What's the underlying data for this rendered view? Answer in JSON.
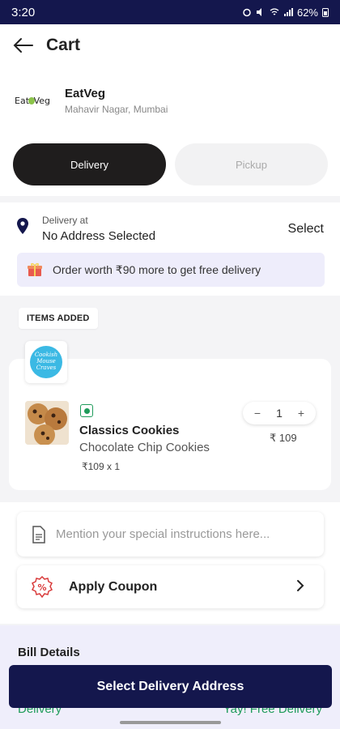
{
  "status_bar": {
    "time": "3:20",
    "battery": "62%"
  },
  "header": {
    "title": "Cart"
  },
  "restaurant": {
    "logo_text_left": "Eat",
    "logo_text_right": "Veg",
    "name": "EatVeg",
    "address": "Mahavir Nagar, Mumbai"
  },
  "mode_toggle": {
    "delivery_label": "Delivery",
    "pickup_label": "Pickup"
  },
  "delivery": {
    "label": "Delivery at",
    "value": "No Address Selected",
    "select_label": "Select",
    "promo_text": "Order worth ₹90 more to get free delivery"
  },
  "items_section": {
    "tag": "ITEMS ADDED"
  },
  "brand": {
    "logo_text": "Cookish Mouse Craves"
  },
  "items": [
    {
      "name": "Classics Cookies",
      "description": "Chocolate Chip Cookies",
      "price_line": "₹109 x 1",
      "quantity": "1",
      "total": "₹ 109"
    }
  ],
  "instructions": {
    "placeholder": "Mention your special instructions here..."
  },
  "coupon": {
    "label": "Apply Coupon"
  },
  "bill": {
    "title": "Bill Details",
    "left_partial": "Delivery",
    "right_partial": "Yay! Free Delivery"
  },
  "cta": {
    "label": "Select Delivery Address"
  },
  "colors": {
    "primary": "#14174d",
    "accent_green": "#1e9b5a",
    "promo_bg": "#eeedfb"
  }
}
